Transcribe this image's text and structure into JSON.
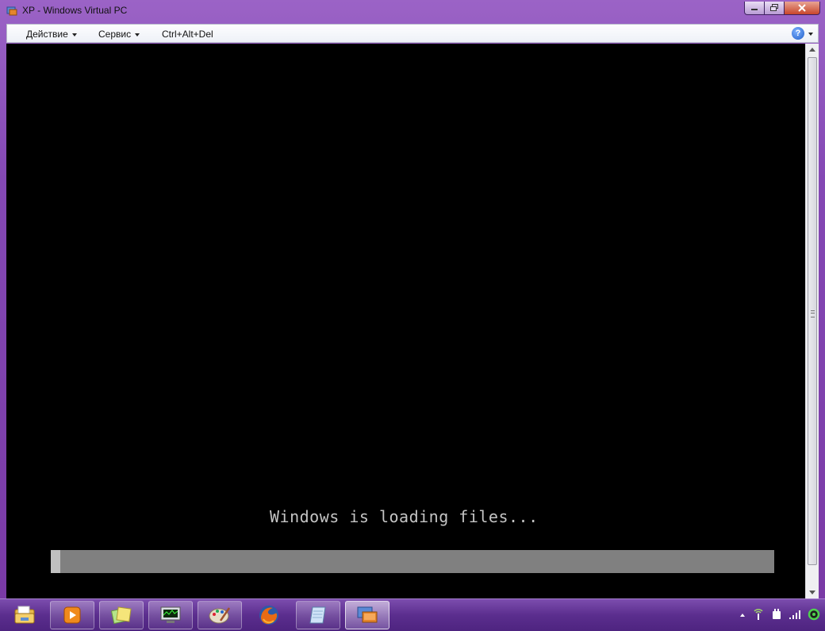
{
  "window": {
    "title": "XP - Windows Virtual PC",
    "accent": "#7a3aa6"
  },
  "menu": {
    "items": [
      {
        "label": "Действие",
        "dropdown": true
      },
      {
        "label": "Сервис",
        "dropdown": true
      },
      {
        "label": "Ctrl+Alt+Del",
        "dropdown": false
      }
    ],
    "help_icon": "help-icon",
    "help_glyph": "?"
  },
  "vm_screen": {
    "message": "Windows is loading files...",
    "progress_fraction": 0.013
  },
  "taskbar": {
    "pinned": [
      {
        "name": "explorer-icon"
      },
      {
        "name": "media-player-icon"
      },
      {
        "name": "sticky-notes-icon"
      },
      {
        "name": "task-manager-icon"
      },
      {
        "name": "paint-icon"
      },
      {
        "name": "firefox-icon"
      },
      {
        "name": "notepad-icon"
      },
      {
        "name": "virtual-pc-icon",
        "active": true
      }
    ],
    "tray": [
      "show-hidden-icons-arrow",
      "network-icon",
      "power-icon",
      "signal-icon",
      "status-icon"
    ]
  }
}
